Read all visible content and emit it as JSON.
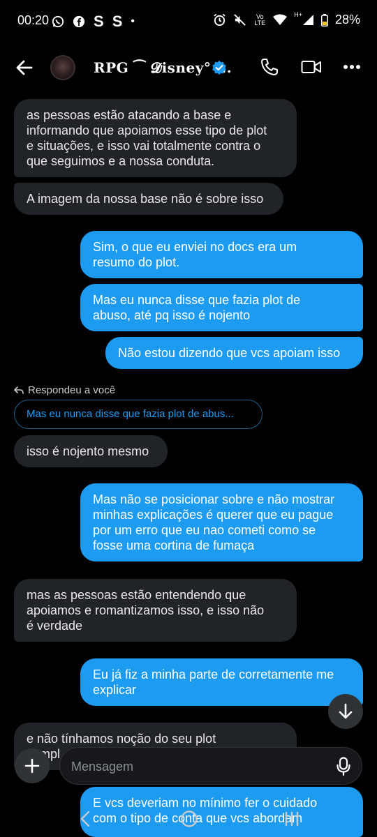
{
  "status_bar": {
    "time": "00:20",
    "left_icons": [
      "whatsapp-icon",
      "facebook-icon",
      "S",
      "S",
      "•"
    ],
    "network": "Vo LTE",
    "signal_type": "H+",
    "battery": "28%"
  },
  "header": {
    "title": "RPG ⁀ 𝓓isney° ...",
    "verified": true
  },
  "messages": [
    {
      "side": "in",
      "text_lines": [
        "as pessoas estão atacando a base e",
        "informando que apoiamos esse tipo de plot",
        "e situações, e isso vai totalmente contra o",
        "que seguimos e a nossa conduta."
      ]
    },
    {
      "side": "in",
      "text_lines": [
        "A imagem da nossa base não é sobre isso"
      ]
    },
    {
      "side": "out",
      "text_lines": [
        "Sim, o que eu enviei no docs era um",
        "resumo do plot."
      ]
    },
    {
      "side": "out",
      "text_lines": [
        "Mas eu nunca disse que fazia plot de",
        "abuso, até pq isso é nojento"
      ]
    },
    {
      "side": "out",
      "text_lines": [
        "Não estou dizendo que vcs apoiam isso"
      ]
    },
    {
      "side": "in",
      "text_lines": [
        "isso é nojento mesmo"
      ]
    },
    {
      "side": "out",
      "text_lines": [
        "Mas não se posicionar sobre e não mostrar",
        "minhas explicações é querer que eu pague",
        "por um erro que eu nao cometi como se",
        "fosse uma cortina de fumaça"
      ]
    },
    {
      "side": "in",
      "text_lines": [
        "mas as pessoas estão entendendo que",
        "apoiamos e romantizamos isso, e isso não",
        "é verdade"
      ]
    },
    {
      "side": "out",
      "text_lines": [
        "Eu já fiz a minha parte de corretamente me",
        "explicar"
      ]
    },
    {
      "side": "in",
      "text_lines": [
        "e não tínhamos noção do seu plot",
        "compl"
      ]
    },
    {
      "side": "out",
      "text_lines": [
        "E vcs deveriam no mínimo fer o cuidado",
        "com o tipo de conta que vcs abordam"
      ]
    }
  ],
  "reply": {
    "label": "Respondeu a você",
    "quoted_text": "Mas eu nunca disse que fazia plot de abus..."
  },
  "composer": {
    "placeholder": "Mensagem"
  },
  "colors": {
    "background": "#000000",
    "incoming_bubble": "#202327",
    "outgoing_bubble": "#1d9bf0",
    "verified": "#1d9bf0"
  }
}
